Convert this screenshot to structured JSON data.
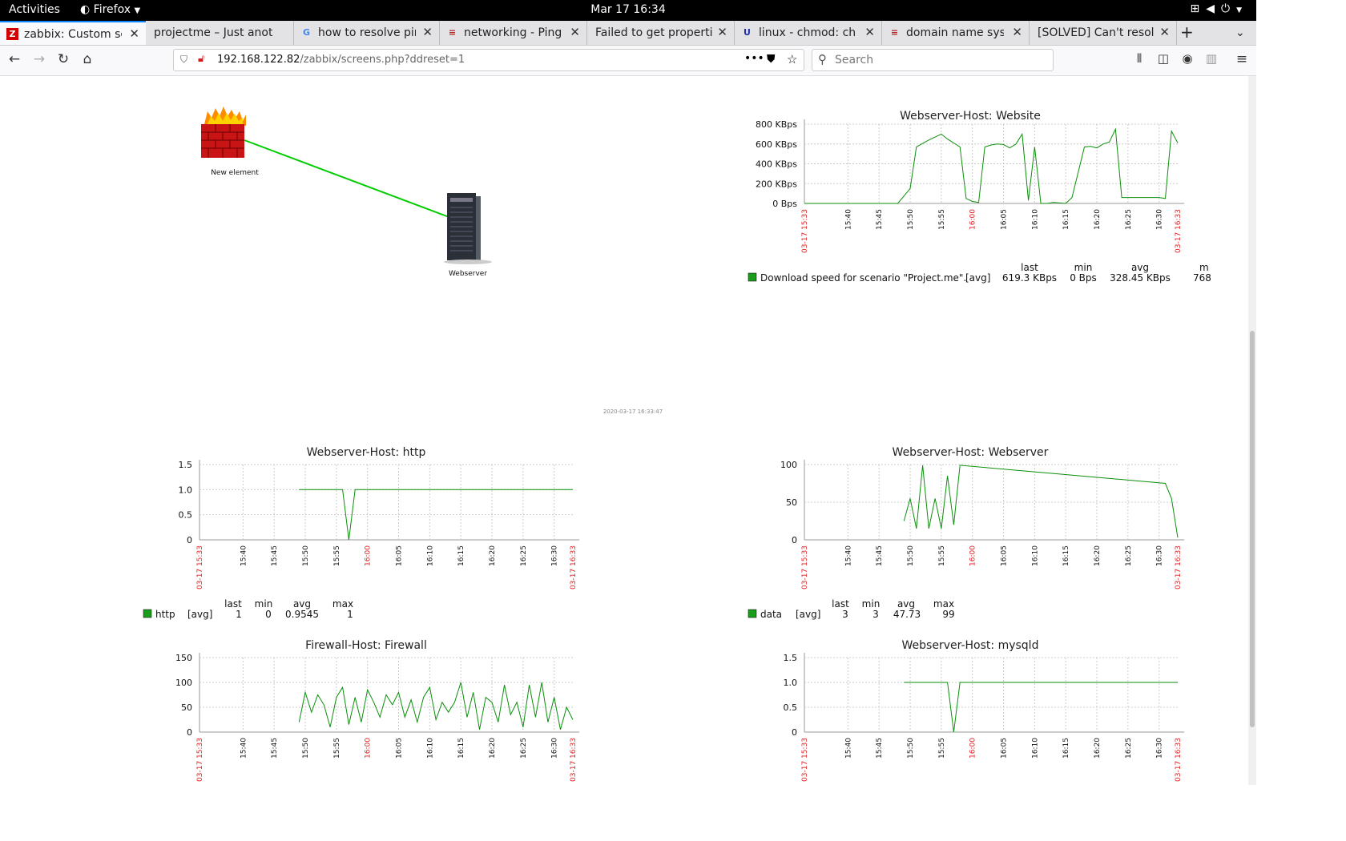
{
  "system_bar": {
    "activities": "Activities",
    "app_menu": "Firefox",
    "clock": "Mar 17  16:34"
  },
  "tabs": [
    {
      "title": "zabbix: Custom scree",
      "icon": "zabbix-icon",
      "active": true
    },
    {
      "title": "projectme – Just anothe",
      "icon": "none"
    },
    {
      "title": "how to resolve ping:",
      "icon": "google-icon"
    },
    {
      "title": "networking - Ping: se",
      "icon": "stackexchange-icon"
    },
    {
      "title": "Failed to get properties",
      "icon": "none"
    },
    {
      "title": "linux - chmod: chang",
      "icon": "unix-icon"
    },
    {
      "title": "domain name system",
      "icon": "stackexchange-icon"
    },
    {
      "title": "[SOLVED] Can't resolve",
      "icon": "none"
    }
  ],
  "urlbar": {
    "host": "192.168.122.82",
    "path": "/zabbix/screens.php?ddreset=1"
  },
  "search": {
    "placeholder": "Search"
  },
  "map": {
    "nodes": [
      {
        "label": "New element",
        "icon": "firewall-icon"
      },
      {
        "label": "Webserver",
        "icon": "server-icon"
      }
    ],
    "link_color": "#00cc00"
  },
  "timestamp": "2020-03-17 16:33:47",
  "graphs": [
    {
      "title": "Webserver-Host: Website",
      "y_ticks": [
        "800 KBps",
        "600 KBps",
        "400 KBps",
        "200 KBps",
        "0 Bps"
      ],
      "legend": {
        "name": "Download speed for scenario \"Project.me\".",
        "func": "[avg]",
        "headers": [
          "last",
          "min",
          "avg",
          "m"
        ],
        "values": [
          "619.3 KBps",
          "0 Bps",
          "328.45 KBps",
          "768"
        ]
      }
    },
    {
      "title": "Webserver-Host: http",
      "y_ticks": [
        "1.5",
        "1.0",
        "0.5",
        "0"
      ],
      "legend": {
        "name": "http",
        "func": "[avg]",
        "headers": [
          "last",
          "min",
          "avg",
          "max"
        ],
        "values": [
          "1",
          "0",
          "0.9545",
          "1"
        ]
      }
    },
    {
      "title": "Webserver-Host: Webserver",
      "y_ticks": [
        "100",
        "50",
        "0"
      ],
      "legend": {
        "name": "data",
        "func": "[avg]",
        "headers": [
          "last",
          "min",
          "avg",
          "max"
        ],
        "values": [
          "3",
          "3",
          "47.73",
          "99"
        ]
      }
    },
    {
      "title": "Firewall-Host: Firewall",
      "y_ticks": [
        "150",
        "100",
        "50",
        "0"
      ]
    },
    {
      "title": "Webserver-Host: mysqld",
      "y_ticks": [
        "1.5",
        "1.0",
        "0.5",
        "0"
      ]
    }
  ],
  "x_ticks": [
    "03-17 15:33",
    "15:40",
    "15:45",
    "15:50",
    "15:55",
    "16:00",
    "16:05",
    "16:10",
    "16:15",
    "16:20",
    "16:25",
    "16:30",
    "03-17 16:33"
  ],
  "x_ticks_red": [
    true,
    false,
    false,
    false,
    false,
    true,
    false,
    false,
    false,
    false,
    false,
    false,
    true
  ],
  "chart_data": [
    {
      "type": "line",
      "title": "Webserver-Host: Website",
      "ylabel": "",
      "ylim": [
        0,
        800
      ],
      "y_unit": "KBps",
      "series": [
        {
          "name": "Download speed for scenario \"Project.me\".",
          "x": [
            "15:33",
            "15:45",
            "15:48",
            "15:50",
            "15:51",
            "15:53",
            "15:55",
            "15:56",
            "15:58",
            "15:59",
            "16:00",
            "16:01",
            "16:02",
            "16:03",
            "16:04",
            "16:05",
            "16:06",
            "16:07",
            "16:08",
            "16:09",
            "16:10",
            "16:11",
            "16:12",
            "16:13",
            "16:15",
            "16:16",
            "16:18",
            "16:19",
            "16:20",
            "16:21",
            "16:22",
            "16:23",
            "16:24",
            "16:26",
            "16:28",
            "16:30",
            "16:31",
            "16:32",
            "16:33"
          ],
          "values": [
            0,
            0,
            0,
            150,
            570,
            640,
            700,
            650,
            570,
            50,
            20,
            10,
            570,
            590,
            600,
            595,
            560,
            600,
            700,
            30,
            570,
            0,
            0,
            10,
            0,
            60,
            570,
            575,
            560,
            600,
            620,
            750,
            60,
            60,
            60,
            60,
            50,
            730,
            610
          ]
        }
      ]
    },
    {
      "type": "line",
      "title": "Webserver-Host: http",
      "ylim": [
        0,
        1.5
      ],
      "series": [
        {
          "name": "http",
          "x": [
            "15:49",
            "15:56",
            "15:57",
            "15:58",
            "16:31",
            "16:33"
          ],
          "values": [
            1,
            1,
            0,
            1,
            1,
            1
          ]
        }
      ]
    },
    {
      "type": "line",
      "title": "Webserver-Host: Webserver",
      "ylim": [
        0,
        100
      ],
      "series": [
        {
          "name": "data",
          "x": [
            "15:49",
            "15:50",
            "15:51",
            "15:52",
            "15:53",
            "15:54",
            "15:55",
            "15:56",
            "15:57",
            "15:58",
            "16:31",
            "16:32",
            "16:33"
          ],
          "values": [
            25,
            55,
            15,
            99,
            15,
            55,
            15,
            85,
            20,
            99,
            75,
            55,
            3
          ]
        }
      ]
    },
    {
      "type": "line",
      "title": "Firewall-Host: Firewall",
      "ylim": [
        0,
        150
      ],
      "series": [
        {
          "name": "",
          "x": [
            "15:49",
            "15:50",
            "15:51",
            "15:52",
            "15:53",
            "15:54",
            "15:55",
            "15:56",
            "15:57",
            "15:58",
            "15:59",
            "16:00",
            "16:01",
            "16:02",
            "16:03",
            "16:04",
            "16:05",
            "16:06",
            "16:07",
            "16:08",
            "16:09",
            "16:10",
            "16:11",
            "16:12",
            "16:13",
            "16:14",
            "16:15",
            "16:16",
            "16:17",
            "16:18",
            "16:19",
            "16:20",
            "16:21",
            "16:22",
            "16:23",
            "16:24",
            "16:25",
            "16:26",
            "16:27",
            "16:28",
            "16:29",
            "16:30",
            "16:31",
            "16:32",
            "16:33"
          ],
          "values": [
            20,
            80,
            40,
            75,
            55,
            10,
            70,
            90,
            15,
            70,
            20,
            85,
            60,
            30,
            75,
            55,
            80,
            30,
            65,
            20,
            70,
            90,
            25,
            60,
            40,
            60,
            100,
            30,
            80,
            5,
            70,
            60,
            20,
            95,
            35,
            60,
            10,
            95,
            30,
            100,
            20,
            70,
            5,
            50,
            25
          ]
        }
      ]
    },
    {
      "type": "line",
      "title": "Webserver-Host: mysqld",
      "ylim": [
        0,
        1.5
      ],
      "series": [
        {
          "name": "",
          "x": [
            "15:49",
            "15:56",
            "15:57",
            "15:58",
            "16:31",
            "16:33"
          ],
          "values": [
            1,
            1,
            0,
            1,
            1,
            1
          ]
        }
      ]
    }
  ]
}
